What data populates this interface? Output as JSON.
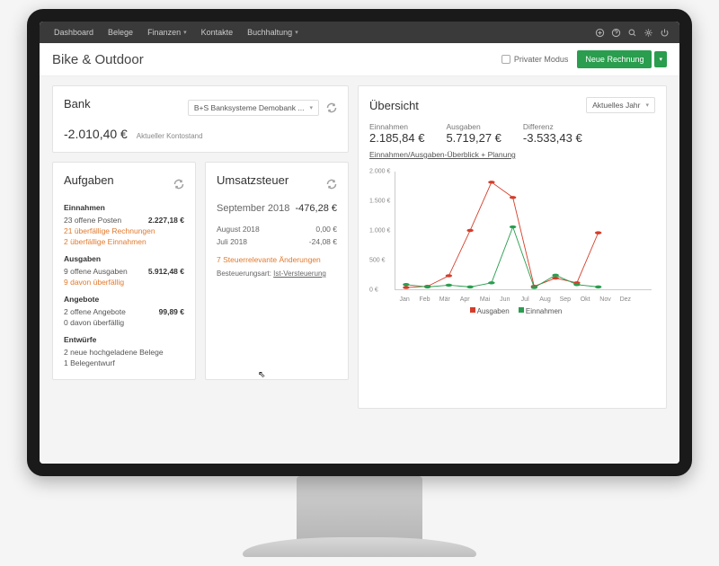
{
  "nav": {
    "items": [
      "Dashboard",
      "Belege",
      "Finanzen",
      "Kontakte",
      "Buchhaltung"
    ],
    "has_dropdown": [
      false,
      false,
      true,
      false,
      true
    ]
  },
  "header": {
    "title": "Bike & Outdoor",
    "private_mode_label": "Privater Modus",
    "new_invoice_label": "Neue Rechnung"
  },
  "bank": {
    "title": "Bank",
    "account_select": "B+S Banksysteme Demobank ...",
    "balance": "-2.010,40 €",
    "balance_label": "Aktueller Kontostand"
  },
  "tasks": {
    "title": "Aufgaben",
    "income_header": "Einnahmen",
    "income_lines": [
      {
        "text": "23  offene Posten",
        "val": "2.227,18 €",
        "orange": false
      },
      {
        "text": "21  überfällige Rechnungen",
        "val": "",
        "orange": true
      },
      {
        "text": "2  überfällige Einnahmen",
        "val": "",
        "orange": true
      }
    ],
    "expense_header": "Ausgaben",
    "expense_lines": [
      {
        "text": "9  offene Ausgaben",
        "val": "5.912,48 €",
        "orange": false
      },
      {
        "text": "9  davon überfällig",
        "val": "",
        "orange": true
      }
    ],
    "offers_header": "Angebote",
    "offers_lines": [
      {
        "text": "2  offene Angebote",
        "val": "99,89 €",
        "orange": false
      },
      {
        "text": "0  davon überfällig",
        "val": "",
        "orange": false
      }
    ],
    "drafts_header": "Entwürfe",
    "drafts_lines": [
      {
        "text": "2  neue hochgeladene Belege",
        "val": "",
        "orange": false
      },
      {
        "text": "1  Belegentwurf",
        "val": "",
        "orange": false
      }
    ]
  },
  "vat": {
    "title": "Umsatzsteuer",
    "month": "September 2018",
    "value": "-476,28 €",
    "rows": [
      {
        "label": "August 2018",
        "val": "0,00 €"
      },
      {
        "label": "Juli 2018",
        "val": "-24,08 €"
      }
    ],
    "changes_link": "7 Steuerrelevante Änderungen",
    "tax_type_label": "Besteuerungsart:",
    "tax_type_value": "Ist-Versteuerung"
  },
  "overview": {
    "title": "Übersicht",
    "period_select": "Aktuelles Jahr",
    "kpis": [
      {
        "label": "Einnahmen",
        "value": "2.185,84 €"
      },
      {
        "label": "Ausgaben",
        "value": "5.719,27 €"
      },
      {
        "label": "Differenz",
        "value": "-3.533,43 €"
      }
    ],
    "link": "Einnahmen/Ausgaben-Überblick + Planung",
    "legend": {
      "ausgaben": "Ausgaben",
      "einnahmen": "Einnahmen"
    }
  },
  "chart_data": {
    "type": "line",
    "categories": [
      "Jan",
      "Feb",
      "Mär",
      "Apr",
      "Mai",
      "Jun",
      "Jul",
      "Aug",
      "Sep",
      "Okt",
      "Nov",
      "Dez"
    ],
    "series": [
      {
        "name": "Ausgaben",
        "color": "#d43d2a",
        "values": [
          30,
          50,
          230,
          1000,
          1820,
          1560,
          50,
          190,
          110,
          960,
          null,
          null
        ]
      },
      {
        "name": "Einnahmen",
        "color": "#2a9d4e",
        "values": [
          80,
          40,
          70,
          40,
          110,
          1060,
          30,
          240,
          80,
          40,
          null,
          null
        ]
      }
    ],
    "xlabel": "",
    "ylabel": "",
    "ylim": [
      0,
      2000
    ],
    "yticks": [
      0,
      500,
      1000,
      1500,
      2000
    ],
    "ytick_labels": [
      "0 €",
      "500 €",
      "1.000 €",
      "1.500 €",
      "2.000 €"
    ]
  }
}
